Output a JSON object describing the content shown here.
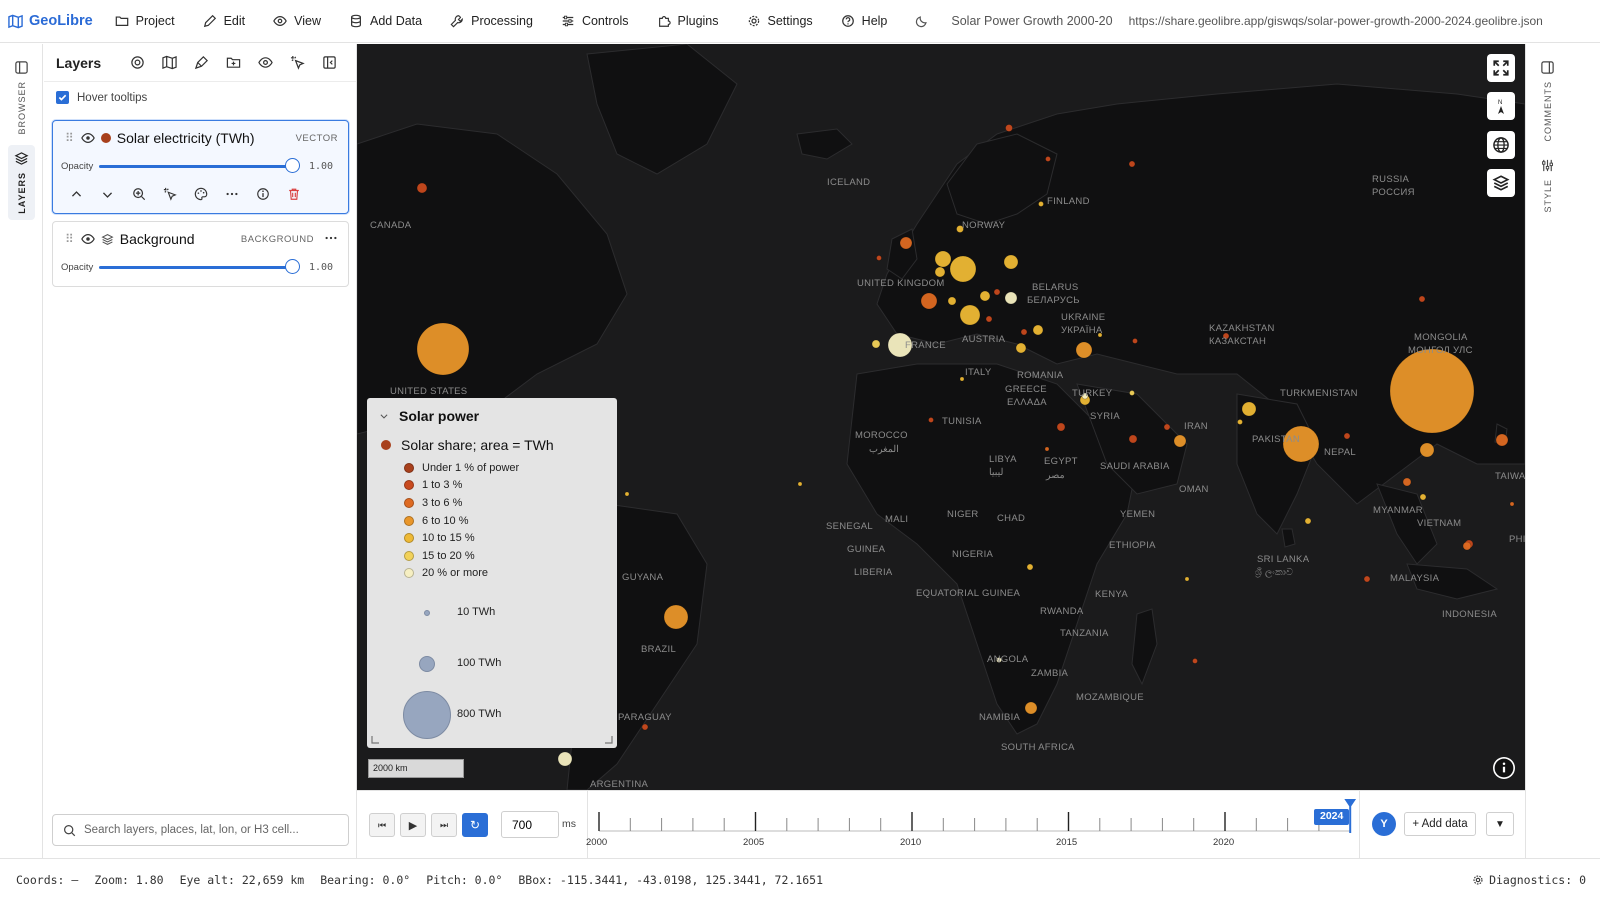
{
  "menu": {
    "brand": "GeoLibre",
    "items": [
      "Project",
      "Edit",
      "View",
      "Add Data",
      "Processing",
      "Controls",
      "Plugins",
      "Settings",
      "Help"
    ],
    "project_title": "Solar Power Growth 2000-20",
    "project_url": "https://share.geolibre.app/giswqs/solar-power-growth-2000-2024.geolibre.json"
  },
  "left_rail": {
    "browser": "BROWSER",
    "layers": "LAYERS"
  },
  "right_rail": {
    "comments": "COMMENTS",
    "style": "STYLE"
  },
  "panel": {
    "title": "Layers",
    "hover_tooltips": "Hover tooltips",
    "layers": [
      {
        "name": "Solar electricity (TWh)",
        "kind": "VECTOR",
        "opacity_label": "Opacity",
        "opacity": "1.00",
        "color": "#a8401c"
      },
      {
        "name": "Background",
        "kind": "BACKGROUND",
        "opacity_label": "Opacity",
        "opacity": "1.00"
      }
    ],
    "search_placeholder": "Search layers, places, lat, lon, or H3 cell..."
  },
  "map_labels": [
    "ICELAND",
    "RUSSIA",
    "РОССИЯ",
    "CANADA",
    "FINLAND",
    "NORWAY",
    "UNITED KINGDOM",
    "BELARUS",
    "БЕЛАРУСЬ",
    "UKRAINE",
    "УКРАЇНА",
    "KAZAKHSTAN",
    "КАЗАКСТАН",
    "MONGOLIA",
    "МОНГОЛ УЛС",
    "FRANCE",
    "AUSTRIA",
    "ITALY",
    "ROMANIA",
    "GREECE",
    "ΕΛΛΑΔΑ",
    "TURKEY",
    "TURKMENISTAN",
    "UNITED STATES",
    "SYRIA",
    "IRAN",
    "TUNISIA",
    "MOROCCO",
    "المغرب",
    "PAKISTAN",
    "NEPAL",
    "LIBYA",
    "ليبيا",
    "EGYPT",
    "مصر",
    "SAUDI ARABIA",
    "OMAN",
    "YEMEN",
    "MYANMAR",
    "VIETNAM",
    "TAIWAN",
    "PHILIPPINES",
    "NIGER",
    "CHAD",
    "MALI",
    "SENEGAL",
    "GUINEA",
    "LIBERIA",
    "NIGERIA",
    "ETHIOPIA",
    "SRI LANKA",
    "ශ්‍රී ලංකාව",
    "MALAYSIA",
    "INDONESIA",
    "EQUATORIAL GUINEA",
    "KENYA",
    "GUYANA",
    "BRAZIL",
    "RWANDA",
    "TANZANIA",
    "ANGOLA",
    "ZAMBIA",
    "MOZAMBIQUE",
    "NAMIBIA",
    "SOUTH AFRICA",
    "PARAGUAY",
    "ARGENTINA"
  ],
  "legend": {
    "title": "Solar power",
    "subtitle": "Solar share; area = TWh",
    "subtitle_color": "#a8401c",
    "classes": [
      {
        "label": "Under 1 % of power",
        "color": "#a8401c"
      },
      {
        "label": "1 to 3 %",
        "color": "#c84a1e"
      },
      {
        "label": "3 to 6 %",
        "color": "#de6a22"
      },
      {
        "label": "6 to 10 %",
        "color": "#e9962a"
      },
      {
        "label": "10 to 15 %",
        "color": "#eeb935"
      },
      {
        "label": "15 to 20 %",
        "color": "#f2d25a"
      },
      {
        "label": "20 % or more",
        "color": "#f6efc2"
      }
    ],
    "sizes": [
      {
        "label": "10 TWh",
        "twh": 10
      },
      {
        "label": "100 TWh",
        "twh": 100
      },
      {
        "label": "800 TWh",
        "twh": 800
      }
    ]
  },
  "scalebar": "2000 km",
  "timeline": {
    "interval": "700",
    "unit": "ms",
    "current_year": "2024",
    "year_labels": [
      "2000",
      "2005",
      "2010",
      "2015",
      "2020"
    ]
  },
  "actions": {
    "avatar": "Y",
    "add_data": "+ Add data"
  },
  "status": {
    "coords": "Coords: —",
    "zoom": "Zoom: 1.80",
    "eye_alt": "Eye alt: 22,659 km",
    "bearing": "Bearing: 0.0°",
    "pitch": "Pitch: 0.0°",
    "bbox": "BBox: -115.3441, -43.0198, 125.3441, 72.1651",
    "diagnostics": "Diagnostics: 0"
  }
}
